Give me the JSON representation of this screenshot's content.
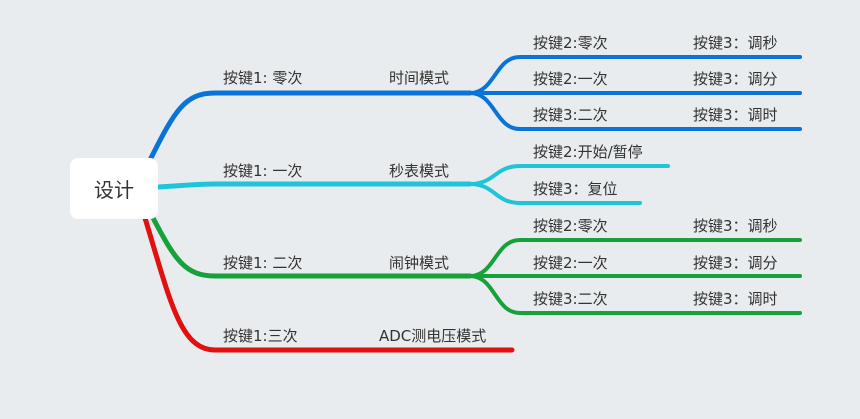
{
  "root": {
    "label": "设计"
  },
  "branches": [
    {
      "color": "#0a73d9",
      "edge_label": "按键1: 零次",
      "mode": "时间模式",
      "children": [
        {
          "left": "按键2:零次",
          "right": "按键3：调秒"
        },
        {
          "left": "按键2:一次",
          "right": "按键3：调分"
        },
        {
          "left": "按键3:二次",
          "right": "按键3：调时"
        }
      ]
    },
    {
      "color": "#1ec5d8",
      "edge_label": "按键1: 一次",
      "mode": "秒表模式",
      "children": [
        {
          "left": "按键2:开始/暂停"
        },
        {
          "left": "按键3：复位"
        }
      ]
    },
    {
      "color": "#17a13a",
      "edge_label": "按键1: 二次",
      "mode": "闹钟模式",
      "children": [
        {
          "left": "按键2:零次",
          "right": "按键3：调秒"
        },
        {
          "left": "按键2:一次",
          "right": "按键3：调分"
        },
        {
          "left": "按键3:二次",
          "right": "按键3：调时"
        }
      ]
    },
    {
      "color": "#e21010",
      "edge_label": "按键1:三次",
      "mode": "ADC测电压模式",
      "children": []
    }
  ]
}
